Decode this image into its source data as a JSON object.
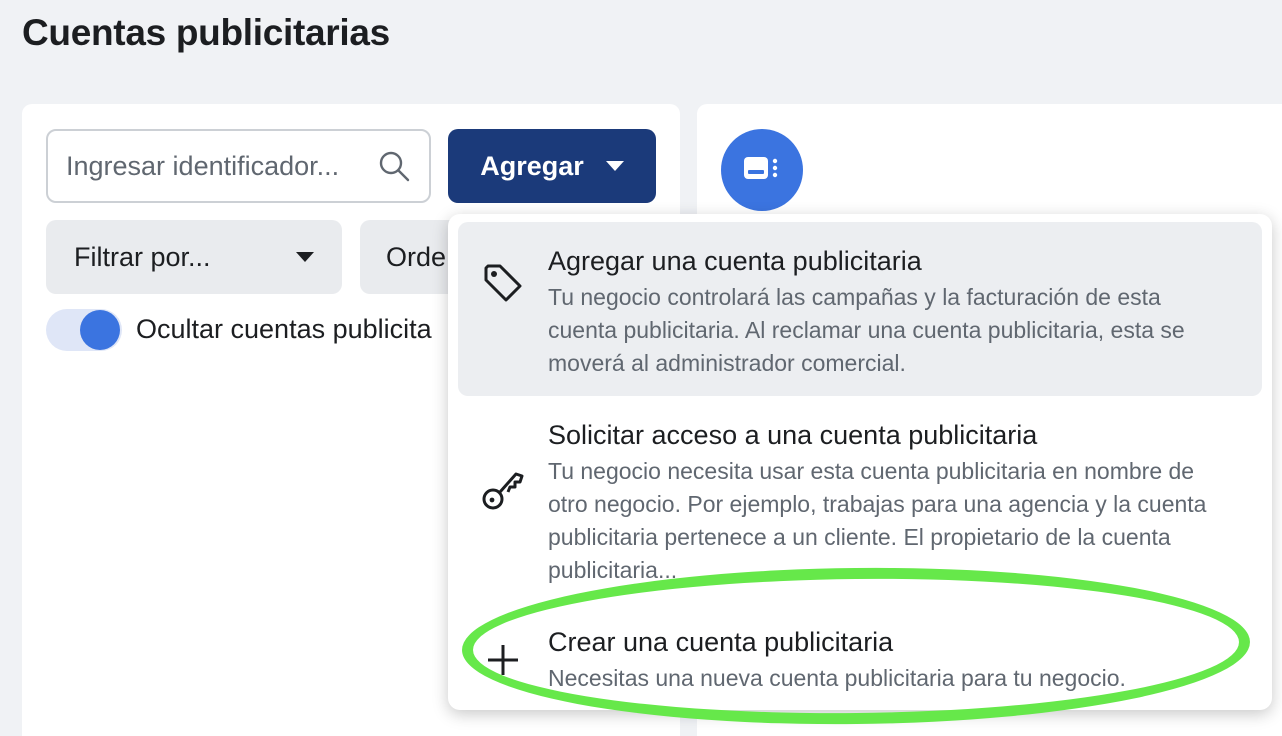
{
  "page": {
    "title": "Cuentas publicitarias"
  },
  "search": {
    "placeholder": "Ingresar identificador..."
  },
  "toolbar": {
    "add_label": "Agregar",
    "filter_label": "Filtrar por...",
    "order_label": "Orde"
  },
  "toggle": {
    "label": "Ocultar cuentas publicita",
    "checked": true
  },
  "menu": {
    "items": [
      {
        "title": "Agregar una cuenta publicitaria",
        "description": "Tu negocio controlará las campañas y la facturación de esta cuenta publicitaria. Al reclamar una cuenta publicitaria, esta se moverá al administrador comercial.",
        "icon": "tag-icon"
      },
      {
        "title": "Solicitar acceso a una cuenta publicitaria",
        "description": "Tu negocio necesita usar esta cuenta publicitaria en nombre de otro negocio. Por ejemplo, trabajas para una agencia y la cuenta publicitaria pertenece a un cliente. El propietario de la cuenta publicitaria...",
        "icon": "key-icon"
      },
      {
        "title": "Crear una cuenta publicitaria",
        "description": "Necesitas una nueva cuenta publicitaria para tu negocio.",
        "icon": "plus-icon"
      }
    ]
  },
  "colors": {
    "primary_button": "#1b3a7a",
    "accent": "#3b74e0",
    "highlight": "#66e84a"
  }
}
